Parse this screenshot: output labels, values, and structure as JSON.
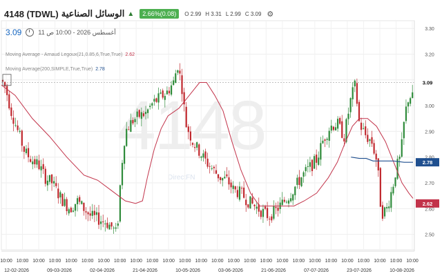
{
  "header": {
    "symbol": "4148 (TDWL)",
    "name": "الوسائل الصناعية",
    "change_badge": "2.66%(0.08)",
    "ohlc": [
      "O 2.99",
      "H 3.31",
      "L 2.99",
      "C 3.09"
    ],
    "last_price": "3.09",
    "timestamp": "11 أغسطس 2026 - 10:00 ص"
  },
  "indicators": [
    {
      "label": "Moving Average - Arnaud Legoux(21,0.85,6,True,True)",
      "value": "2.62",
      "color": "#c2334a"
    },
    {
      "label": "Moving Average(200,SIMPLE,True,True)",
      "value": "2.78",
      "color": "#1f4f8f"
    }
  ],
  "watermark": {
    "ticker": "4148",
    "brand": "DirectFN"
  },
  "colors": {
    "up": "#2e8b3a",
    "down": "#c0272d",
    "alma": "#c2334a",
    "sma": "#1f4f8f"
  },
  "chart_data": {
    "type": "candlestick",
    "ylim": [
      2.44,
      3.33
    ],
    "y_ticks": [
      2.5,
      2.6,
      2.7,
      2.8,
      2.9,
      3.0,
      3.1,
      3.2,
      3.3
    ],
    "y_tick_labels": [
      "2.50",
      "2.60",
      "2.70",
      "2.80",
      "2.90",
      "3.00",
      "3.10",
      "3.20",
      "3.30"
    ],
    "x_tick_times": [
      "10:00",
      "10:00",
      "10:00",
      "10:00",
      "10:00",
      "10:00",
      "10:00",
      "10:00",
      "10:00",
      "10:00",
      "10:00",
      "10:00",
      "10:00",
      "10:00",
      "10:00",
      "10:00",
      "10:00",
      "10:00",
      "10:00",
      "10:00",
      "10:00",
      "10:00",
      "10:00",
      "10:00",
      "10:00",
      "10:00"
    ],
    "x_tick_dates": [
      "12-02-2026",
      "09-03-2026",
      "02-04-2026",
      "21-04-2026",
      "10-05-2026",
      "03-06-2026",
      "21-06-2026",
      "07-07-2026",
      "23-07-2026",
      "10-08-2026"
    ],
    "price_path": [
      [
        0,
        3.1
      ],
      [
        6,
        3.07
      ],
      [
        14,
        2.98
      ],
      [
        24,
        2.9
      ],
      [
        34,
        2.82
      ],
      [
        44,
        2.79
      ],
      [
        54,
        2.77
      ],
      [
        64,
        2.72
      ],
      [
        74,
        2.7
      ],
      [
        82,
        2.66
      ],
      [
        92,
        2.62
      ],
      [
        100,
        2.6
      ],
      [
        110,
        2.63
      ],
      [
        120,
        2.6
      ],
      [
        130,
        2.57
      ],
      [
        140,
        2.56
      ],
      [
        150,
        2.55
      ],
      [
        160,
        2.53
      ],
      [
        168,
        2.5
      ],
      [
        174,
        2.75
      ],
      [
        180,
        2.9
      ],
      [
        190,
        2.94
      ],
      [
        200,
        2.96
      ],
      [
        210,
        2.97
      ],
      [
        220,
        3.01
      ],
      [
        230,
        3.03
      ],
      [
        240,
        3.05
      ],
      [
        250,
        3.09
      ],
      [
        256,
        3.16
      ],
      [
        262,
        3.08
      ],
      [
        268,
        2.93
      ],
      [
        278,
        2.86
      ],
      [
        288,
        2.82
      ],
      [
        298,
        2.78
      ],
      [
        308,
        2.75
      ],
      [
        318,
        2.72
      ],
      [
        328,
        2.71
      ],
      [
        338,
        2.67
      ],
      [
        348,
        2.66
      ],
      [
        358,
        2.63
      ],
      [
        368,
        2.61
      ],
      [
        378,
        2.59
      ],
      [
        388,
        2.57
      ],
      [
        398,
        2.59
      ],
      [
        408,
        2.62
      ],
      [
        418,
        2.65
      ],
      [
        428,
        2.69
      ],
      [
        438,
        2.73
      ],
      [
        448,
        2.76
      ],
      [
        458,
        2.79
      ],
      [
        468,
        2.87
      ],
      [
        478,
        2.92
      ],
      [
        488,
        2.93
      ],
      [
        498,
        2.88
      ],
      [
        508,
        3.03
      ],
      [
        514,
        3.08
      ],
      [
        520,
        2.93
      ],
      [
        530,
        2.88
      ],
      [
        538,
        2.86
      ],
      [
        546,
        2.78
      ],
      [
        552,
        2.58
      ],
      [
        560,
        2.6
      ],
      [
        568,
        2.68
      ],
      [
        574,
        2.76
      ],
      [
        580,
        2.8
      ],
      [
        586,
        2.96
      ],
      [
        592,
        3.04
      ],
      [
        598,
        3.03
      ]
    ],
    "alma_path": [
      [
        0,
        3.08
      ],
      [
        20,
        3.04
      ],
      [
        45,
        2.95
      ],
      [
        70,
        2.88
      ],
      [
        95,
        2.8
      ],
      [
        120,
        2.73
      ],
      [
        140,
        2.71
      ],
      [
        160,
        2.67
      ],
      [
        180,
        2.63
      ],
      [
        195,
        2.62
      ],
      [
        205,
        2.63
      ],
      [
        212,
        2.72
      ],
      [
        222,
        2.83
      ],
      [
        232,
        2.91
      ],
      [
        242,
        2.96
      ],
      [
        258,
        2.99
      ],
      [
        270,
        3.03
      ],
      [
        288,
        3.09
      ],
      [
        298,
        3.09
      ],
      [
        310,
        3.04
      ],
      [
        322,
        2.98
      ],
      [
        335,
        2.86
      ],
      [
        348,
        2.75
      ],
      [
        362,
        2.66
      ],
      [
        375,
        2.61
      ],
      [
        392,
        2.61
      ],
      [
        408,
        2.61
      ],
      [
        425,
        2.61
      ],
      [
        440,
        2.63
      ],
      [
        458,
        2.66
      ],
      [
        475,
        2.72
      ],
      [
        488,
        2.78
      ],
      [
        500,
        2.86
      ],
      [
        510,
        2.92
      ],
      [
        520,
        2.95
      ],
      [
        532,
        2.95
      ],
      [
        545,
        2.92
      ],
      [
        558,
        2.86
      ],
      [
        570,
        2.78
      ],
      [
        582,
        2.7
      ],
      [
        592,
        2.66
      ],
      [
        598,
        2.64
      ]
    ],
    "sma_path": [
      [
        508,
        2.8
      ],
      [
        520,
        2.795
      ],
      [
        530,
        2.795
      ],
      [
        540,
        2.785
      ],
      [
        555,
        2.785
      ],
      [
        570,
        2.785
      ],
      [
        585,
        2.78
      ],
      [
        598,
        2.78
      ]
    ],
    "series": [
      {
        "name": "Moving Average - Arnaud Legoux(21,0.85,6,True,True)",
        "last": 2.62
      },
      {
        "name": "Moving Average(200,SIMPLE,True,True)",
        "last": 2.78
      }
    ],
    "last_close": 3.09,
    "dashed_reference": 3.09
  }
}
